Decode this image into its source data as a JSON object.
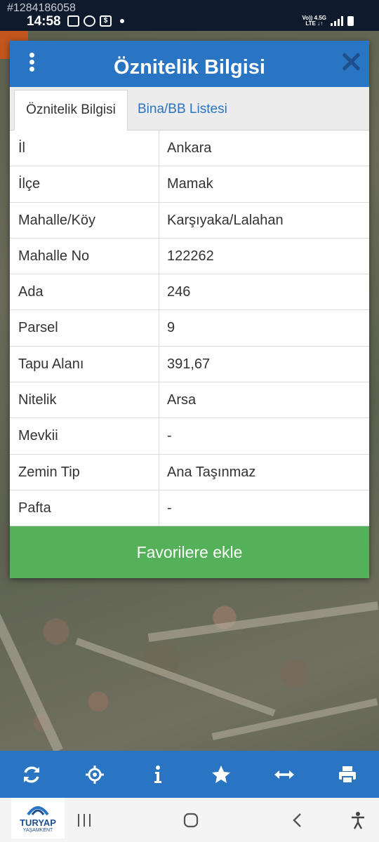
{
  "status_bar": {
    "id_label": "#1284186058",
    "time": "14:58",
    "network_top": "Vo)) 4.5G",
    "network_bottom": "LTE ↓↑"
  },
  "dialog": {
    "title": "Öznitelik Bilgisi",
    "tabs": [
      {
        "label": "Öznitelik Bilgisi",
        "active": true
      },
      {
        "label": "Bina/BB Listesi",
        "active": false
      }
    ],
    "rows": [
      {
        "key": "İl",
        "value": "Ankara"
      },
      {
        "key": "İlçe",
        "value": "Mamak"
      },
      {
        "key": "Mahalle/Köy",
        "value": "Karşıyaka/Lalahan"
      },
      {
        "key": "Mahalle No",
        "value": "122262"
      },
      {
        "key": "Ada",
        "value": "246"
      },
      {
        "key": "Parsel",
        "value": "9"
      },
      {
        "key": "Tapu Alanı",
        "value": "391,67"
      },
      {
        "key": "Nitelik",
        "value": "Arsa"
      },
      {
        "key": "Mevkii",
        "value": "-"
      },
      {
        "key": "Zemin Tip",
        "value": "Ana Taşınmaz"
      },
      {
        "key": "Pafta",
        "value": "-"
      }
    ],
    "favorite_button": "Favorilere ekle"
  },
  "toolbar": {
    "icons": [
      "refresh-icon",
      "locate-icon",
      "info-icon",
      "star-icon",
      "measure-icon",
      "print-icon"
    ]
  },
  "logo": {
    "name": "TURYAP",
    "sub": "YAŞAMKENT"
  },
  "colors": {
    "header_blue": "#2a74c4",
    "button_green": "#55b05a",
    "status_bar": "#0f1b2d"
  }
}
